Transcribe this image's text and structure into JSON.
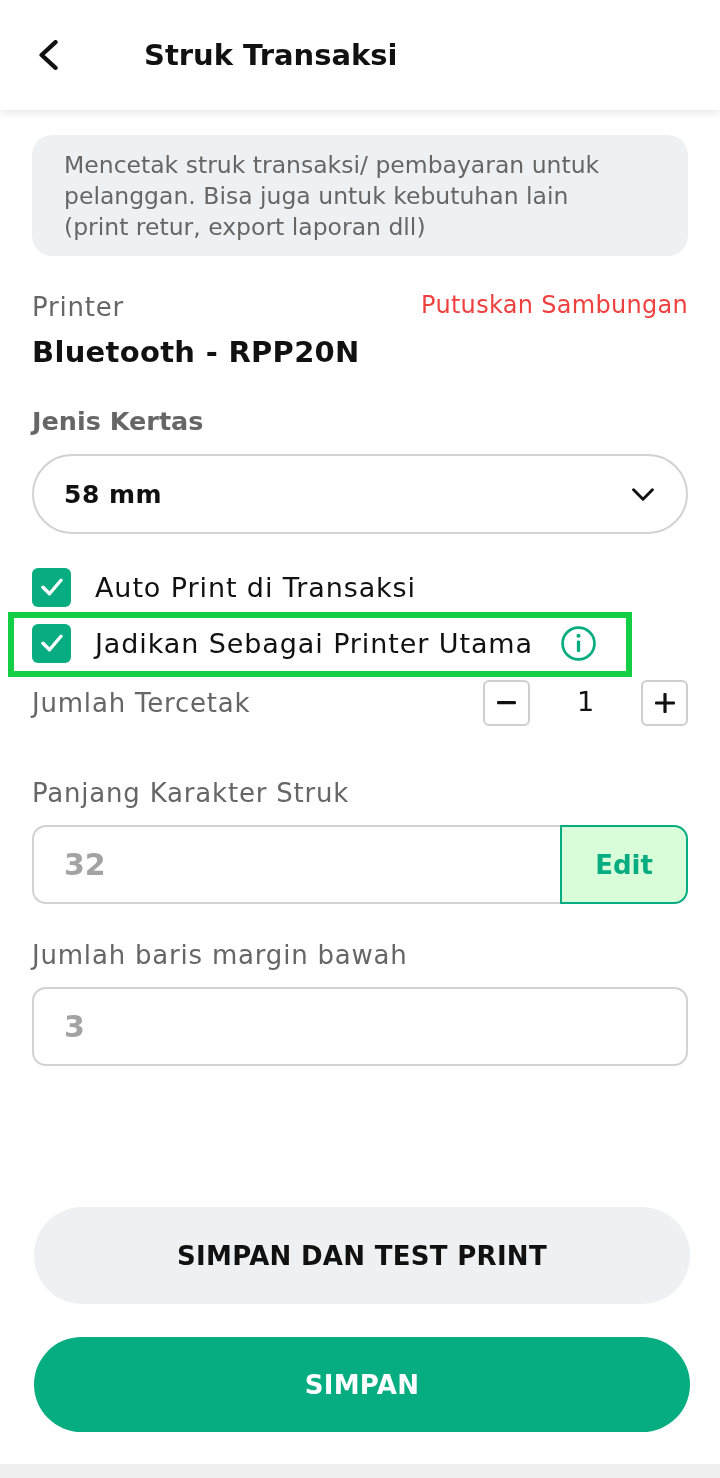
{
  "header": {
    "title": "Struk Transaksi"
  },
  "info": {
    "text": "Mencetak struk transaksi/ pembayaran untuk pelanggan. Bisa juga untuk kebutuhan lain (print retur, export laporan dll)"
  },
  "printer": {
    "label": "Printer",
    "name": "Bluetooth - RPP20N",
    "disconnect": "Putuskan Sambungan"
  },
  "paper": {
    "label": "Jenis Kertas",
    "value": "58 mm"
  },
  "options": [
    {
      "label": "Auto Print di Transaksi",
      "checked": true,
      "highlighted": false,
      "info": false
    },
    {
      "label": "Jadikan Sebagai Printer Utama",
      "checked": true,
      "highlighted": true,
      "info": true
    }
  ],
  "copies": {
    "label": "Jumlah Tercetak",
    "value": "1"
  },
  "fields": [
    {
      "label": "Panjang Karakter Struk",
      "value": "32",
      "disabled": true,
      "action": "Edit"
    },
    {
      "label": "Jumlah baris margin bawah",
      "value": "3",
      "disabled": true
    }
  ],
  "buttons": [
    {
      "label": "SIMPAN DAN TEST PRINT",
      "kind": "secondary"
    },
    {
      "label": "SIMPAN",
      "kind": "primary"
    }
  ]
}
